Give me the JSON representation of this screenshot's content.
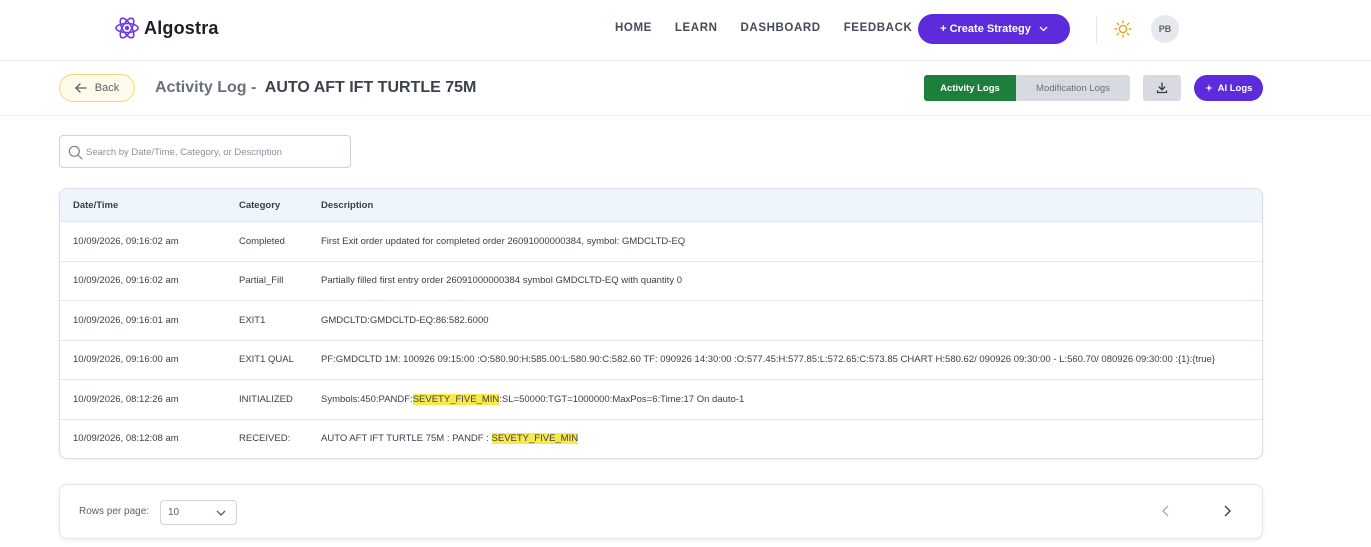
{
  "app": {
    "name": "Algostra",
    "accent": "#5b2bdc"
  },
  "nav": {
    "items": [
      {
        "label": "HOME"
      },
      {
        "label": "LEARN"
      },
      {
        "label": "DASHBOARD"
      },
      {
        "label": "FEEDBACK"
      }
    ],
    "create_label": "+ Create Strategy",
    "theme_icon": "sun-icon",
    "avatar_initials": "PB"
  },
  "header": {
    "back_label": "Back",
    "title_prefix": "Activity Log -",
    "strategy_name": "AUTO AFT IFT TURTLE 75M",
    "tabs": {
      "activity": "Activity Logs",
      "modification": "Modification Logs"
    },
    "ai_label": "AI Logs"
  },
  "search": {
    "placeholder": "Search by Date/Time, Category, or Description"
  },
  "table": {
    "columns": [
      "Date/Time",
      "Category",
      "Description"
    ],
    "rows": [
      {
        "datetime": "10/09/2026, 09:16:02 am",
        "category": "Completed",
        "desc": "First Exit order updated for completed order 26091000000384, symbol: GMDCLTD-EQ"
      },
      {
        "datetime": "10/09/2026, 09:16:02 am",
        "category": "Partial_Fill",
        "desc": "Partially filled first entry order 26091000000384 symbol GMDCLTD-EQ with quantity 0"
      },
      {
        "datetime": "10/09/2026, 09:16:01 am",
        "category": "EXIT1",
        "desc": "GMDCLTD:GMDCLTD-EQ:86:582.6000"
      },
      {
        "datetime": "10/09/2026, 09:16:00 am",
        "category": "EXIT1 QUAL",
        "desc": "PF:GMDCLTD 1M: 100926 09:15:00 :O:580.90:H:585.00:L:580.90:C:582.60 TF: 090926 14:30:00 :O:577.45:H:577.85:L:572.65:C:573.85 CHART H:580.62/ 090926 09:30:00 - L:560.70/ 080926 09:30:00 :{1}:{true}"
      },
      {
        "datetime": "10/09/2026, 08:12:26 am",
        "category": "INITIALIZED",
        "desc_pre": "Symbols:450:PANDF:",
        "desc_hl": "SEVETY_FIVE_MIN",
        "desc_post": ":SL=50000:TGT=1000000:MaxPos=6:Time:17 On dauto-1"
      },
      {
        "datetime": "10/09/2026, 08:12:08 am",
        "category": "RECEIVED:",
        "desc_pre": "AUTO AFT IFT TURTLE 75M : PANDF : ",
        "desc_hl": "SEVETY_FIVE_MIN",
        "desc_post": ""
      }
    ]
  },
  "pagination": {
    "rows_label": "Rows per page:",
    "rows_value": "10"
  }
}
